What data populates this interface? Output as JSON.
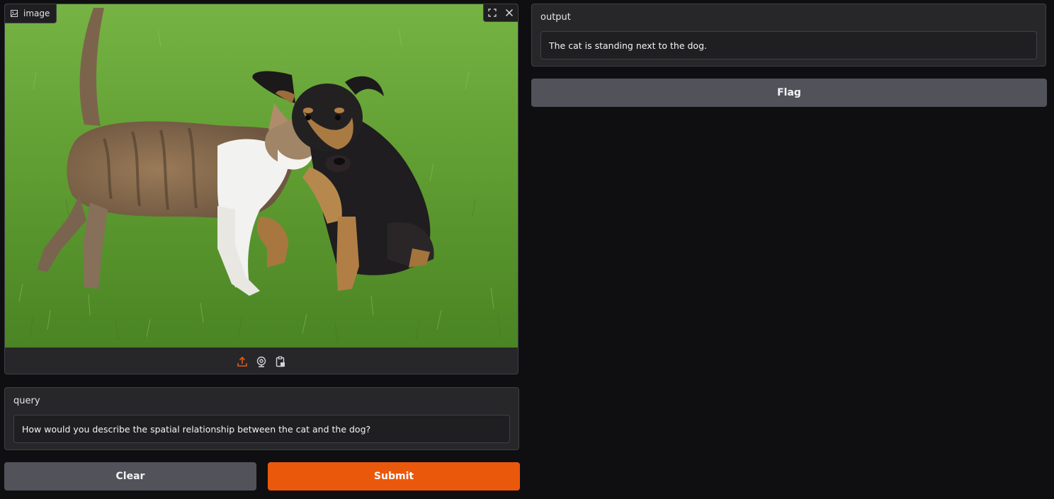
{
  "image_block": {
    "label": "image",
    "photo_description_icon": "cat-and-dog-photo"
  },
  "query": {
    "label": "query",
    "value": "How would you describe the spatial relationship between the cat and the dog?"
  },
  "output": {
    "label": "output",
    "value": "The cat is standing next to the dog."
  },
  "buttons": {
    "clear": "Clear",
    "submit": "Submit",
    "flag": "Flag"
  },
  "colors": {
    "accent": "#ea580c",
    "background": "#0f0f11",
    "panel": "#27272a"
  }
}
